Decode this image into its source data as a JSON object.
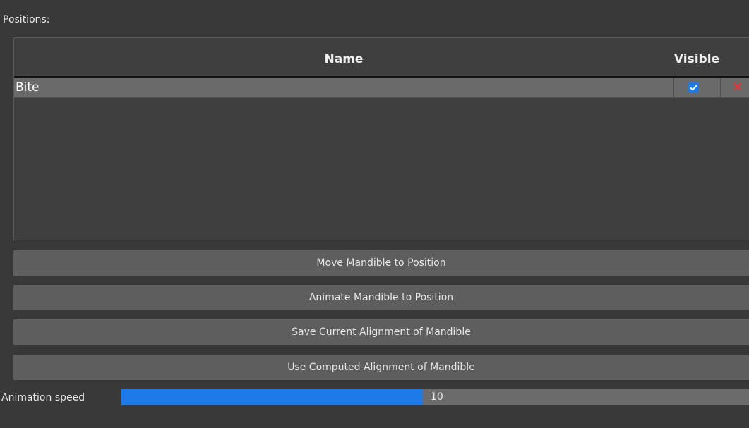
{
  "positions_label": "Positions:",
  "table": {
    "columns": [
      "Name",
      "Visible"
    ],
    "rows": [
      {
        "name": "Bite",
        "visible": true,
        "delete_icon": "close-icon"
      }
    ]
  },
  "buttons": {
    "move": "Move Mandible to Position",
    "animate": "Animate Mandible to Position",
    "save": "Save Current Alignment of Mandible",
    "use_computed": "Use Computed Alignment of Mandible"
  },
  "animation_speed": {
    "label": "Animation speed",
    "value": "10",
    "fill_fraction": 0.48
  },
  "colors": {
    "accent": "#1e7ae6",
    "delete": "#ff2a2a",
    "background": "#383838"
  }
}
